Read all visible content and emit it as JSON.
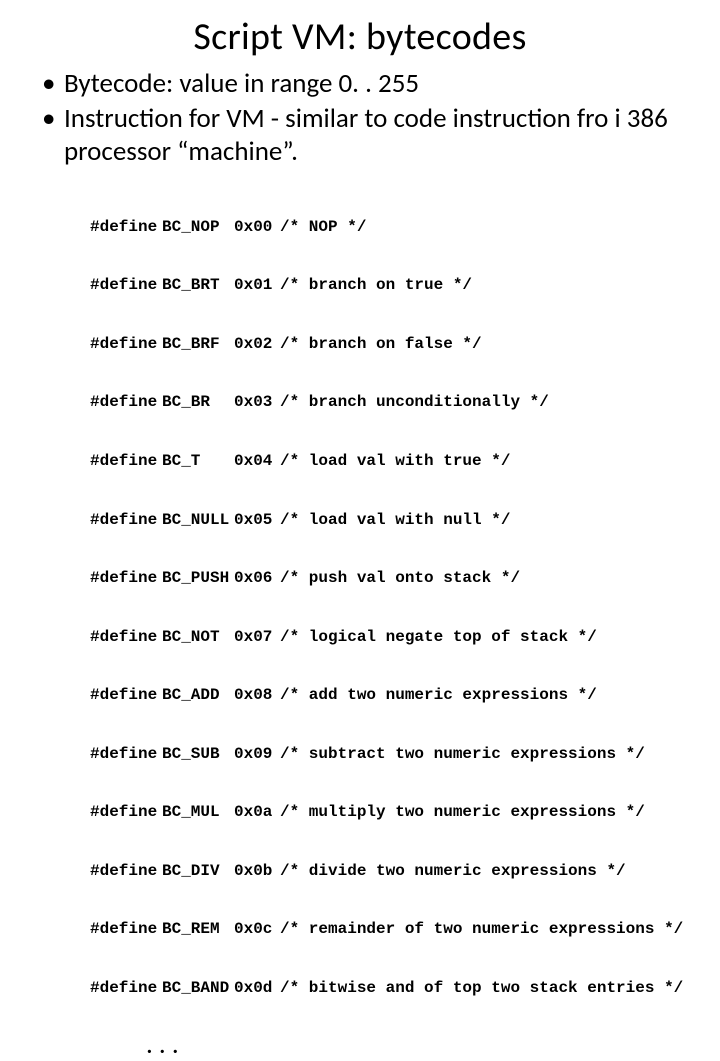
{
  "title": "Script VM: bytecodes",
  "bullets": [
    "Bytecode: value in range 0. . 255",
    "Instruction for VM - similar to code instruction fro i 386 processor “machine”."
  ],
  "defines": [
    {
      "kw": "#define",
      "name": "BC_NOP",
      "val": "0x00",
      "cmt": "/* NOP */"
    },
    {
      "kw": "#define",
      "name": "BC_BRT",
      "val": "0x01",
      "cmt": "/* branch on true */"
    },
    {
      "kw": "#define",
      "name": "BC_BRF",
      "val": "0x02",
      "cmt": "/* branch on false */"
    },
    {
      "kw": "#define",
      "name": "BC_BR",
      "val": "0x03",
      "cmt": "/* branch unconditionally */"
    },
    {
      "kw": "#define",
      "name": "BC_T",
      "val": "0x04",
      "cmt": "/* load val with true */"
    },
    {
      "kw": "#define",
      "name": "BC_NULL",
      "val": "0x05",
      "cmt": "/* load val with null */"
    },
    {
      "kw": "#define",
      "name": "BC_PUSH",
      "val": "0x06",
      "cmt": "/* push val onto stack */"
    },
    {
      "kw": "#define",
      "name": "BC_NOT",
      "val": "0x07",
      "cmt": "/* logical negate top of stack */"
    },
    {
      "kw": "#define",
      "name": "BC_ADD",
      "val": "0x08",
      "cmt": "/* add two numeric expressions */"
    },
    {
      "kw": "#define",
      "name": "BC_SUB",
      "val": "0x09",
      "cmt": "/* subtract two numeric expressions */"
    },
    {
      "kw": "#define",
      "name": "BC_MUL",
      "val": "0x0a",
      "cmt": "/* multiply two numeric expressions */"
    },
    {
      "kw": "#define",
      "name": "BC_DIV",
      "val": "0x0b",
      "cmt": "/* divide two numeric expressions */"
    },
    {
      "kw": "#define",
      "name": "BC_REM",
      "val": "0x0c",
      "cmt": "/* remainder of two numeric expressions */"
    },
    {
      "kw": "#define",
      "name": "BC_BAND",
      "val": "0x0d",
      "cmt": "/* bitwise and of top two stack entries */"
    }
  ],
  "ellipsis": ". . ."
}
